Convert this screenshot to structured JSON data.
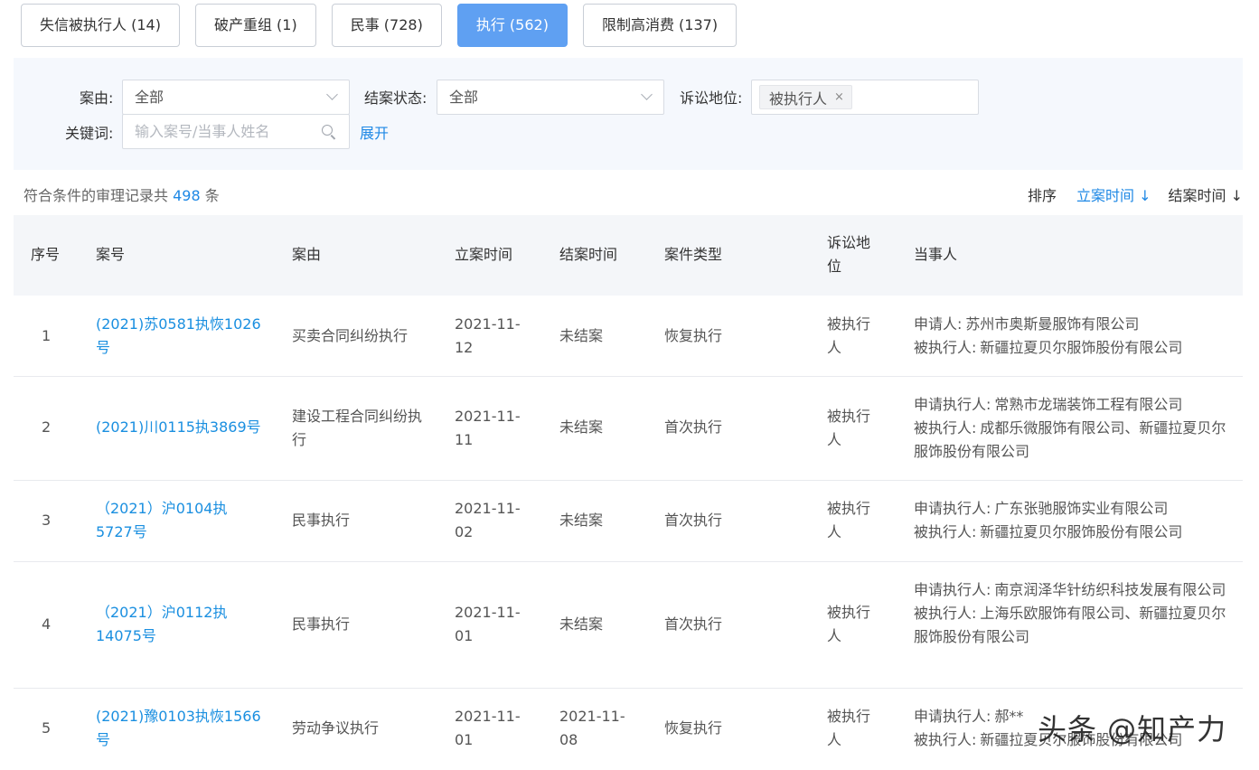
{
  "tabs": [
    {
      "label": "失信被执行人 (14)",
      "active": false
    },
    {
      "label": "破产重组 (1)",
      "active": false
    },
    {
      "label": "民事 (728)",
      "active": false
    },
    {
      "label": "执行 (562)",
      "active": true
    },
    {
      "label": "限制高消费 (137)",
      "active": false
    }
  ],
  "filters": {
    "case_reason": {
      "label": "案由:",
      "value": "全部"
    },
    "status": {
      "label": "结案状态:",
      "value": "全部"
    },
    "position": {
      "label": "诉讼地位:",
      "tag": "被执行人",
      "remove": "×"
    },
    "keyword": {
      "label": "关键词:",
      "placeholder": "输入案号/当事人姓名"
    },
    "expand": "展开"
  },
  "summary": {
    "prefix": "符合条件的审理记录共",
    "count": "498",
    "suffix": "条"
  },
  "sort": {
    "label": "排序",
    "options": [
      "立案时间 ↓",
      "结案时间 ↓"
    ],
    "active": "立案时间 ↓"
  },
  "table": {
    "headers": [
      "序号",
      "案号",
      "案由",
      "立案时间",
      "结案时间",
      "案件类型",
      "诉讼地位",
      "当事人"
    ],
    "rows": [
      {
        "no": "1",
        "case_no": "(2021)苏0581执恢1026号",
        "reason": "买卖合同纠纷执行",
        "filed": "2021-11-12",
        "closed": "未结案",
        "type": "恢复执行",
        "position": "被执行人",
        "parties": [
          {
            "role": "申请人:",
            "name": "苏州市奥斯曼服饰有限公司"
          },
          {
            "role": "被执行人:",
            "name": "新疆拉夏贝尔服饰股份有限公司"
          }
        ]
      },
      {
        "no": "2",
        "case_no": "(2021)川0115执3869号",
        "reason": "建设工程合同纠纷执行",
        "filed": "2021-11-11",
        "closed": "未结案",
        "type": "首次执行",
        "position": "被执行人",
        "parties": [
          {
            "role": "申请执行人:",
            "name": "常熟市龙瑞装饰工程有限公司"
          },
          {
            "role": "被执行人:",
            "name": "成都乐微服饰有限公司、新疆拉夏贝尔服饰股份有限公司"
          }
        ]
      },
      {
        "no": "3",
        "case_no": "（2021）沪0104执5727号",
        "reason": "民事执行",
        "filed": "2021-11-02",
        "closed": "未结案",
        "type": "首次执行",
        "position": "被执行人",
        "parties": [
          {
            "role": "申请执行人:",
            "name": "广东张驰服饰实业有限公司"
          },
          {
            "role": "被执行人:",
            "name": "新疆拉夏贝尔服饰股份有限公司"
          }
        ]
      },
      {
        "no": "4",
        "case_no": "（2021）沪0112执14075号",
        "reason": "民事执行",
        "filed": "2021-11-01",
        "closed": "未结案",
        "type": "首次执行",
        "position": "被执行人",
        "parties": [
          {
            "role": "申请执行人:",
            "name": "南京润泽华针纺织科技发展有限公司"
          },
          {
            "role": "被执行人:",
            "name": "上海乐欧服饰有限公司、新疆拉夏贝尔服饰股份有限公司"
          }
        ]
      },
      {
        "no": "5",
        "case_no": "(2021)豫0103执恢1566号",
        "reason": "劳动争议执行",
        "filed": "2021-11-01",
        "closed": "2021-11-08",
        "type": "恢复执行",
        "position": "被执行人",
        "parties": [
          {
            "role": "申请执行人:",
            "name": "郝**"
          },
          {
            "role": "被执行人:",
            "name": "新疆拉夏贝尔服饰股份有限公司"
          }
        ]
      }
    ]
  },
  "watermark": "头条 @知产力"
}
